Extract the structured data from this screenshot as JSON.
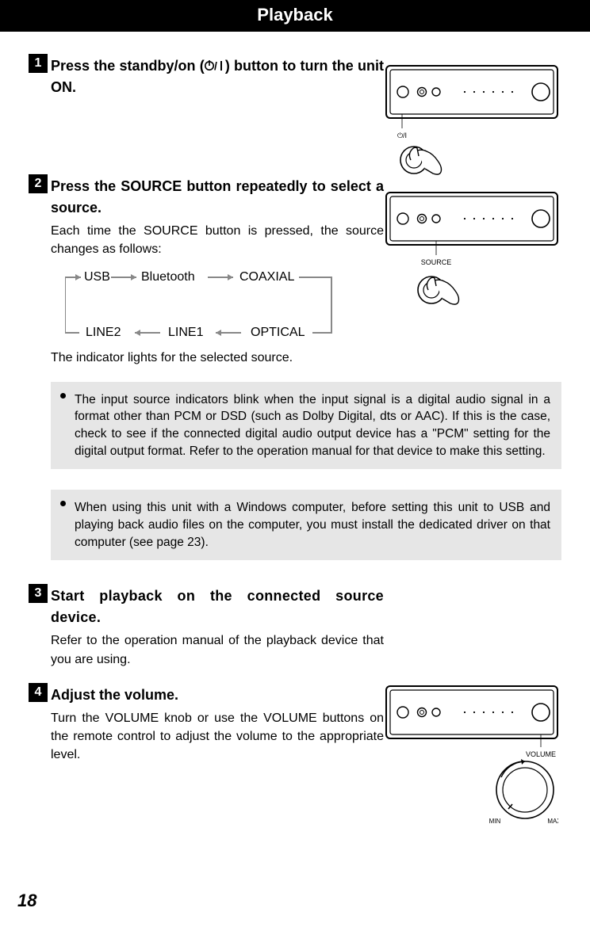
{
  "header": {
    "title": "Playback"
  },
  "steps": {
    "s1": {
      "num": "1",
      "head_a": "Press the standby/on (",
      "head_b": ") button to turn the unit ON."
    },
    "s2": {
      "num": "2",
      "head": "Press the SOURCE button repeatedly to select a source.",
      "body1": "Each time the SOURCE button is pressed, the source changes as follows:",
      "body2": "The indicator lights for the selected source.",
      "cycle": {
        "usb": "USB",
        "bluetooth": "Bluetooth",
        "coaxial": "COAXIAL",
        "optical": "OPTICAL",
        "line1": "LINE1",
        "line2": "LINE2"
      },
      "note1": "The input source indicators blink when the input signal is a digital audio signal in a format other than PCM or DSD (such as Dolby Digital, dts or AAC). If this is the case, check to see if the connected digital audio output device has a \"PCM\" setting for the digital output format. Refer to the operation manual for that device to make this setting.",
      "note2": "When using this unit with a Windows computer, before setting this unit to USB and playing back audio files on the computer, you must install the dedicated driver on that computer (see page 23)."
    },
    "s3": {
      "num": "3",
      "head": "Start playback on the connected source device.",
      "body": "Refer to the operation manual of the playback device that you are using."
    },
    "s4": {
      "num": "4",
      "head": "Adjust the volume.",
      "body": "Turn the VOLUME knob or use the VOLUME buttons on the remote control to adjust the volume to the appropriate level."
    }
  },
  "illus_labels": {
    "standby": "⏻/I",
    "source": "SOURCE",
    "volume": "VOLUME",
    "min": "MIN",
    "max": "MAX"
  },
  "page_number": "18"
}
